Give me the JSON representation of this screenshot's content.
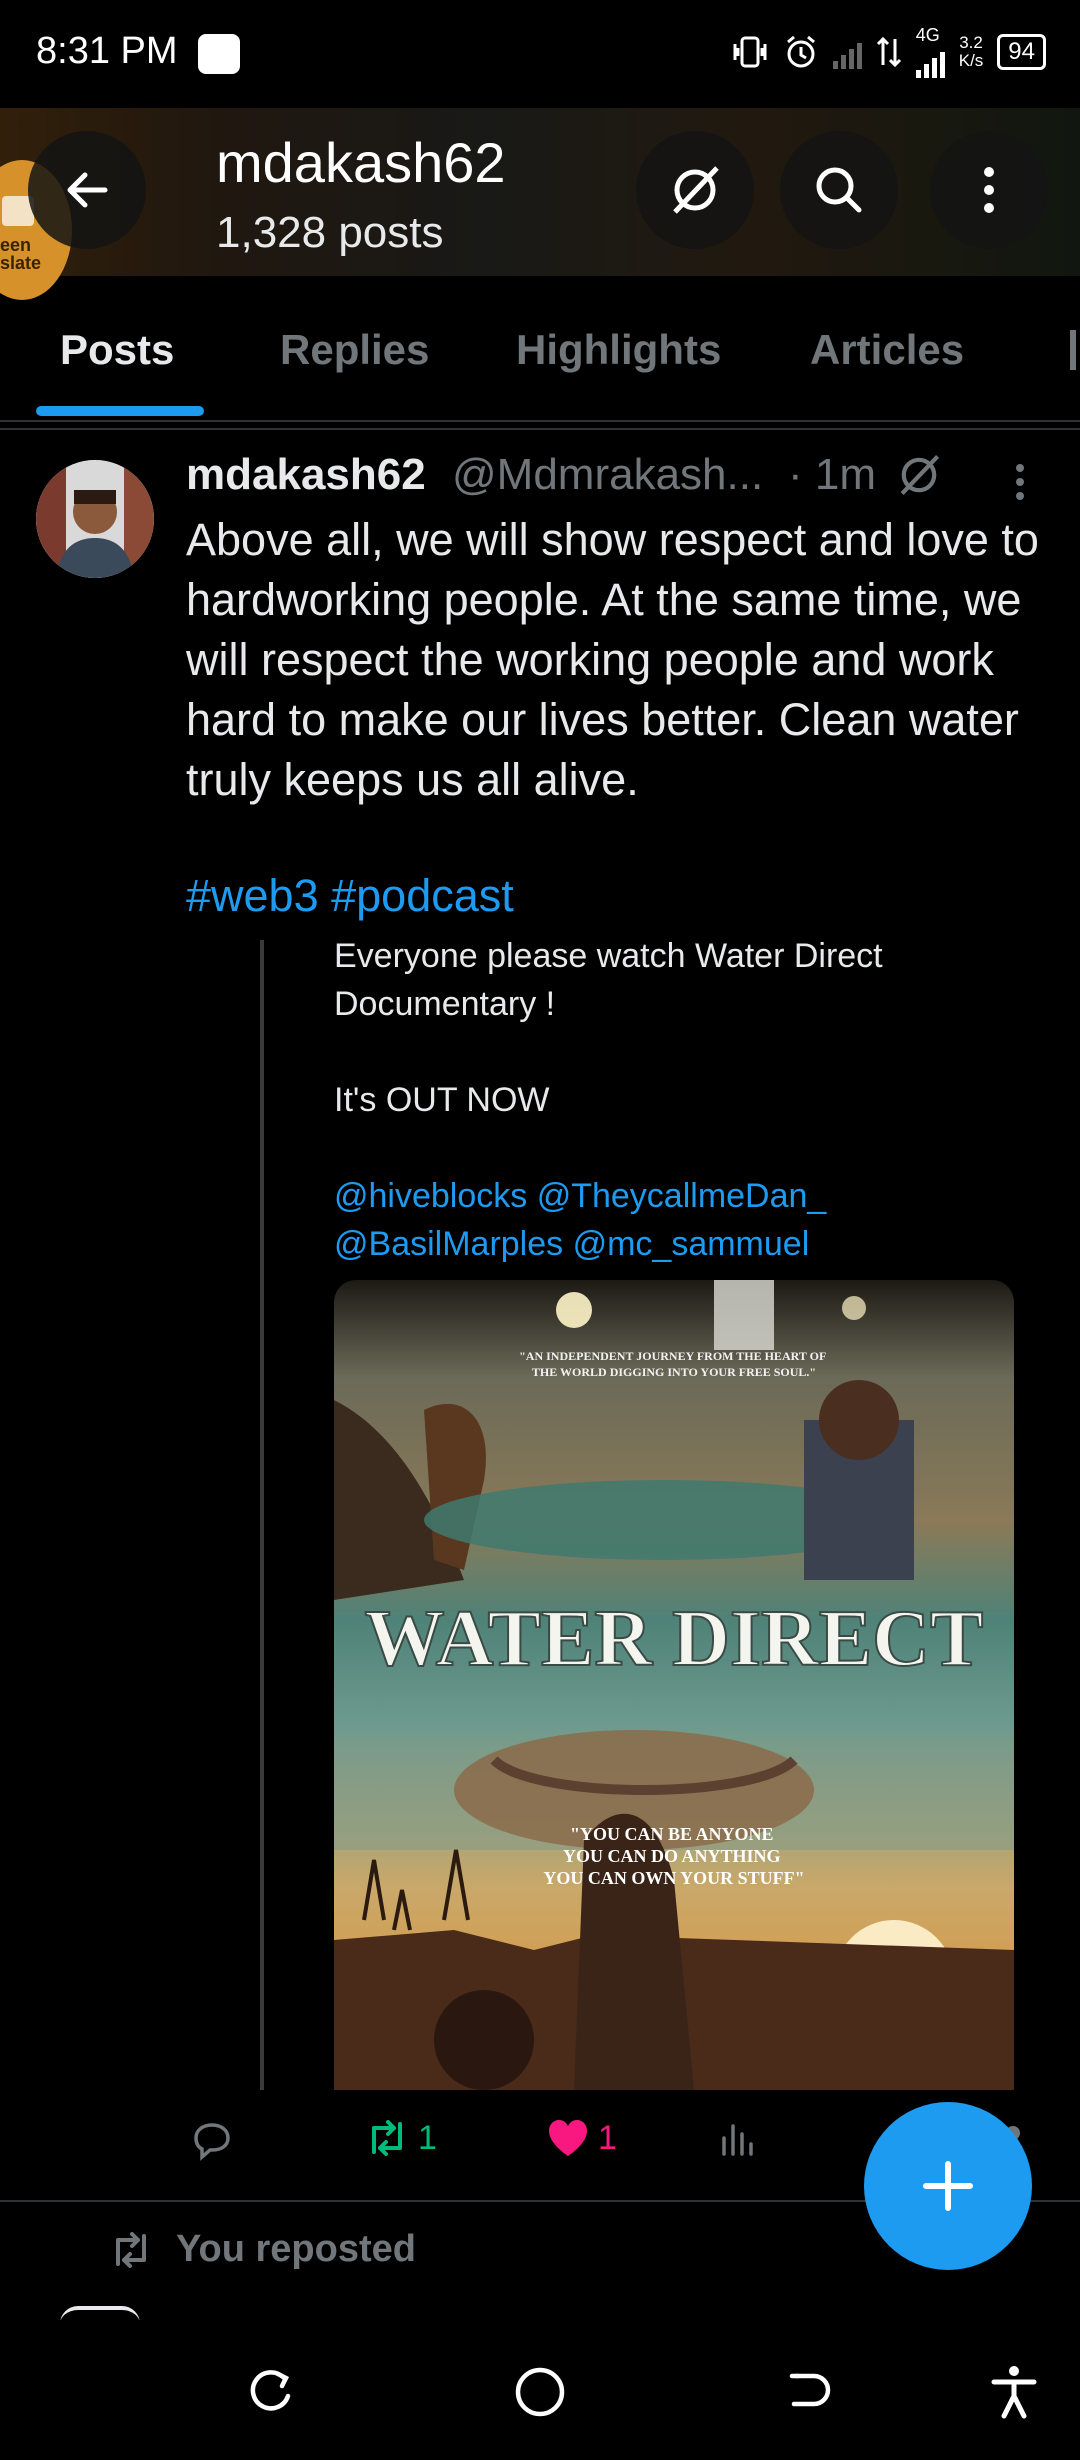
{
  "status_bar": {
    "time": "8:31 PM",
    "network": "4G",
    "speed_value": "3.2",
    "speed_unit": "K/s",
    "battery": "94"
  },
  "header": {
    "title": "mdakash62",
    "post_count": "1,328 posts",
    "translate_badge": "een slate"
  },
  "tabs": [
    {
      "label": "Posts",
      "active": true
    },
    {
      "label": "Replies",
      "active": false
    },
    {
      "label": "Highlights",
      "active": false
    },
    {
      "label": "Articles",
      "active": false
    }
  ],
  "post": {
    "author_name": "mdakash62",
    "author_handle": "@Mdmrakash...",
    "time": "· 1m",
    "text": "Above all, we will show respect and love to hardworking people. At the same time, we will respect the working people and work hard to make our lives better. Clean water truly keeps us all alive.",
    "hashtags": "#web3 #podcast",
    "quote": {
      "line1": "Everyone please watch Water Direct Documentary !",
      "line2": "It's OUT NOW",
      "mentions_line1": "@hiveblocks @TheycallmeDan_",
      "mentions_line2": "@BasilMarples @mc_sammuel"
    },
    "poster": {
      "tagline": "\"AN INDEPENDENT JOURNEY FROM THE HEART OF THE WORLD DIGGING INTO YOUR FREE SOUL.\"",
      "title": "WATER DIRECT",
      "quote_lines": [
        "\"YOU CAN BE ANYONE",
        "YOU CAN DO ANYTHING",
        "YOU CAN OWN YOUR STUFF\""
      ]
    },
    "actions": {
      "reposts": "1",
      "likes": "1"
    }
  },
  "repost_notice": "You reposted",
  "colors": {
    "accent": "#1d9bf0",
    "repost_green": "#00ba7c",
    "like_pink": "#f91880",
    "muted": "#71767b"
  }
}
